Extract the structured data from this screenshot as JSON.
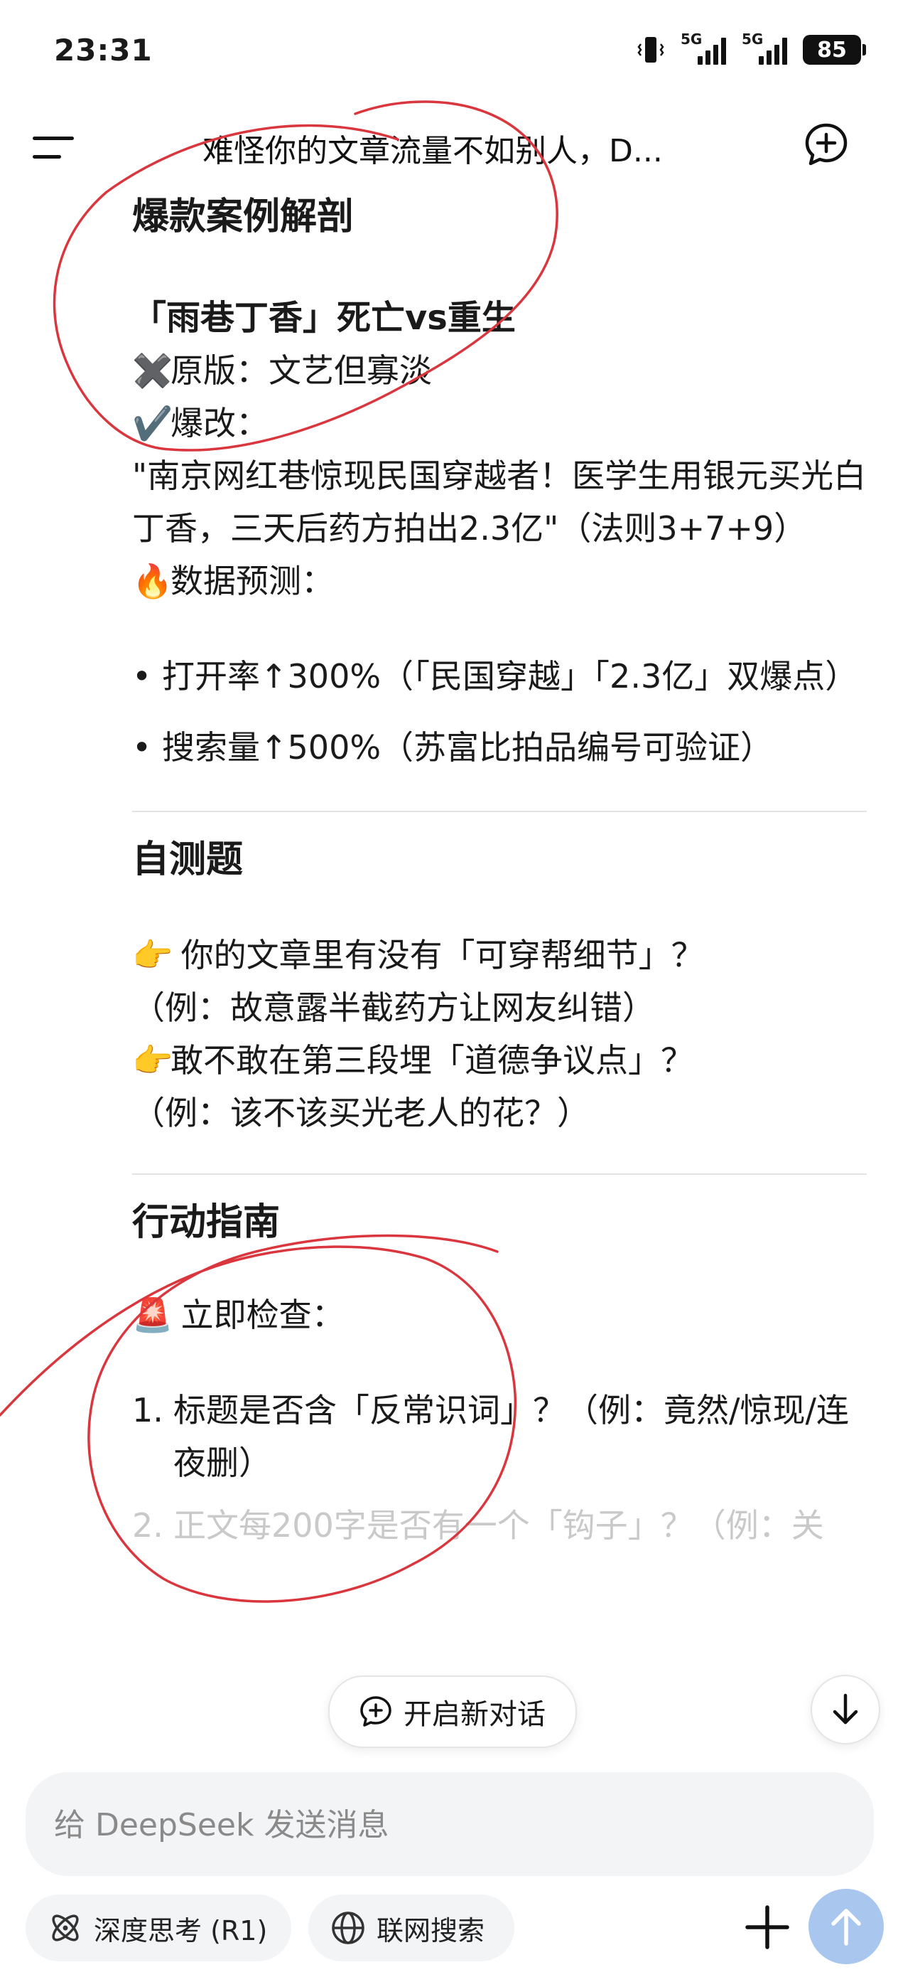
{
  "status_bar": {
    "time": "23:31",
    "net1": "5G",
    "net2": "5G",
    "battery": "85"
  },
  "header": {
    "title": "难怪你的文章流量不如别人，D..."
  },
  "sections": {
    "case": {
      "heading": "爆款案例解剖",
      "subheading": "「雨巷丁香」死亡vs重生",
      "original_icon": "✖️",
      "original": "原版：文艺但寡淡",
      "revised_icon": "✔️",
      "revised": "爆改：",
      "quote": "\"南京网红巷惊现民国穿越者！医学生用银元买光白丁香，三天后药方拍出2.3亿\"（法则3+7+9）",
      "forecast_icon": "🔥",
      "forecast": "数据预测：",
      "bullets": [
        "打开率↑300%（「民国穿越」「2.3亿」双爆点）",
        "搜索量↑500%（苏富比拍品编号可验证）"
      ]
    },
    "selftest": {
      "heading": "自测题",
      "items": [
        {
          "icon": "👉",
          "question": " 你的文章里有没有「可穿帮细节」？",
          "example": "（例：故意露半截药方让网友纠错）"
        },
        {
          "icon": "👉",
          "question": "敢不敢在第三段埋「道德争议点」？",
          "example": "（例：该不该买光老人的花？）"
        }
      ]
    },
    "action": {
      "heading": "行动指南",
      "check_icon": "🚨",
      "check": " 立即检查：",
      "steps": [
        {
          "num": "1.",
          "text": "标题是否含「反常识词」？（例：竟然/惊现/连夜删）"
        },
        {
          "num": "2.",
          "text": "正文每200字是否有一个「钩子」？（例：关"
        }
      ]
    }
  },
  "floating": {
    "new_chat": "开启新对话"
  },
  "composer": {
    "placeholder": "给 DeepSeek 发送消息",
    "deep_think": "深度思考 (R1)",
    "web_search": "联网搜索"
  },
  "colors": {
    "annotation": "#d9363e",
    "send_button": "#a9c6ef",
    "input_bg": "#f3f4f6"
  }
}
